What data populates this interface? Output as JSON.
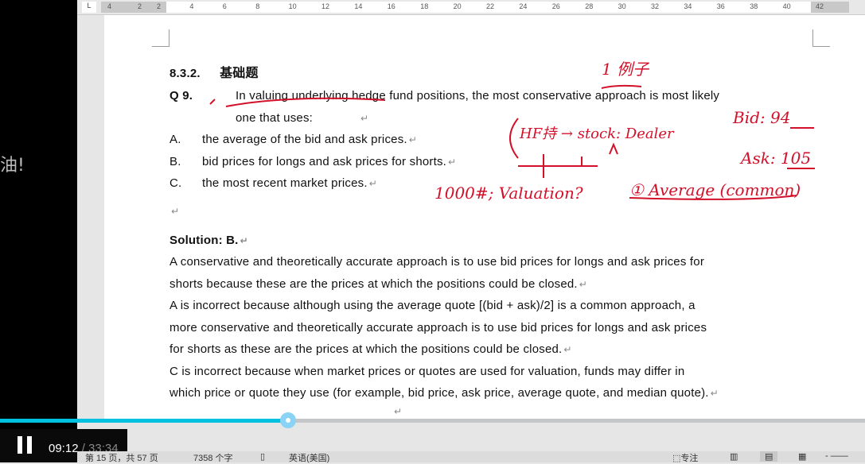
{
  "subtitle_fragment": "油!",
  "ruler": {
    "ticks": [
      "4",
      "2",
      "2",
      "4",
      "6",
      "8",
      "10",
      "12",
      "14",
      "16",
      "18",
      "20",
      "22",
      "24",
      "26",
      "28",
      "30",
      "32",
      "34",
      "36",
      "38",
      "40",
      "42"
    ]
  },
  "document": {
    "section_num": "8.3.2.",
    "section_title": "基础题",
    "question_num": "Q 9.",
    "question_line1": "In valuing underlying hedge fund positions, the most conservative approach is most likely",
    "question_line2": "one that uses:",
    "options": [
      {
        "letter": "A.",
        "text": "the average of the bid and ask prices."
      },
      {
        "letter": "B.",
        "text": "bid prices for longs and ask prices for shorts."
      },
      {
        "letter": "C.",
        "text": "the most recent market prices."
      }
    ],
    "solution_label": "Solution: B.",
    "solution_lines": [
      "A conservative and theoretically accurate approach is to use bid prices for longs and ask prices for",
      "shorts because these are the prices at which the positions could be closed.",
      "A is incorrect because although using the average quote [(bid + ask)/2] is a common approach, a",
      "more conservative and theoretically accurate approach is to use bid prices for longs and ask prices",
      "for shorts as these are the prices at which the positions could be closed.",
      "C is incorrect because when market prices or quotes are used for valuation, funds may differ in",
      "which price or quote they use (for example, bid price, ask price, average quote, and median quote)."
    ],
    "paragraph_mark": "↵"
  },
  "annotations": {
    "example": "1 例子",
    "hf_stock": "HF持 → stock: Dealer",
    "bid": "Bid: 94",
    "ask": "Ask: 105",
    "valuation": "1000#; Valuation?",
    "average": "① Average (common)"
  },
  "player": {
    "current_time": "09:12",
    "total_time": "/ 33:34",
    "progress_percent": 27.5
  },
  "status_bar": {
    "page": "第 15 页，共 57 页",
    "words": "7358 个字",
    "language": "英语(美国)",
    "focus": "专注"
  },
  "colors": {
    "progress": "#00c2e0",
    "ink": "#d3102a"
  }
}
